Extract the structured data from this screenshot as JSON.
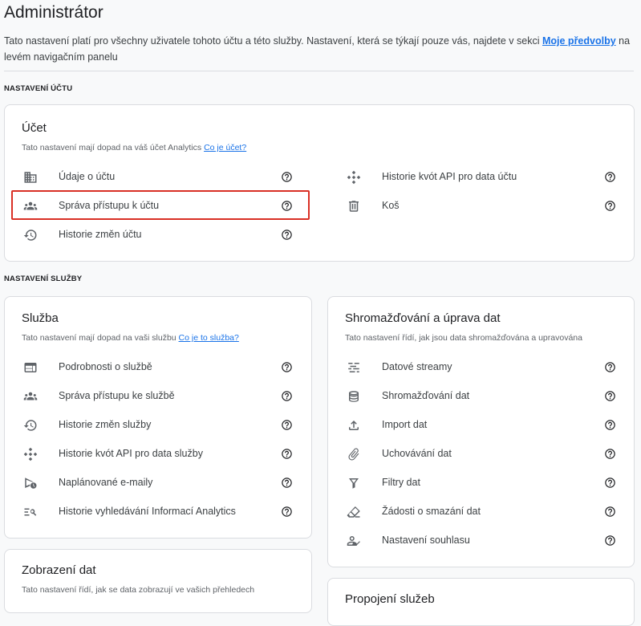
{
  "header": {
    "title": "Administrátor",
    "description_before": "Tato nastavení platí pro všechny uživatele tohoto účtu a této služby. Nastavení, která se týkají pouze vás, najdete v sekci ",
    "description_link": "Moje předvolby",
    "description_after": " na levém navigačním panelu"
  },
  "sections": {
    "account_label": "NASTAVENÍ ÚČTU",
    "property_label": "NASTAVENÍ SLUŽBY"
  },
  "account_card": {
    "title": "Účet",
    "subtitle": "Tato nastavení mají dopad na váš účet Analytics",
    "subtitle_link": "Co je účet?",
    "items": [
      {
        "label": "Údaje o účtu",
        "icon": "building-icon"
      },
      {
        "label": "Správa přístupu k účtu",
        "icon": "people-icon"
      },
      {
        "label": "Historie změn účtu",
        "icon": "history-icon"
      },
      {
        "label": "Historie kvót API pro data účtu",
        "icon": "api-icon"
      },
      {
        "label": "Koš",
        "icon": "trash-icon"
      }
    ]
  },
  "property_card": {
    "title": "Služba",
    "subtitle": "Tato nastavení mají dopad na vaši službu",
    "subtitle_link": "Co je to služba?",
    "items": [
      {
        "label": "Podrobnosti o službě",
        "icon": "web-icon"
      },
      {
        "label": "Správa přístupu ke službě",
        "icon": "people-icon"
      },
      {
        "label": "Historie změn služby",
        "icon": "history-icon"
      },
      {
        "label": "Historie kvót API pro data služby",
        "icon": "api-icon"
      },
      {
        "label": "Naplánované e-maily",
        "icon": "scheduled-send-icon"
      },
      {
        "label": "Historie vyhledávání Informací Analytics",
        "icon": "search-list-icon"
      }
    ]
  },
  "data_card": {
    "title": "Shromažďování a úprava dat",
    "subtitle": "Tato nastavení řídí, jak jsou data shromažďována a upravována",
    "items": [
      {
        "label": "Datové streamy",
        "icon": "streams-icon"
      },
      {
        "label": "Shromažďování dat",
        "icon": "database-icon"
      },
      {
        "label": "Import dat",
        "icon": "upload-icon"
      },
      {
        "label": "Uchovávání dat",
        "icon": "paperclip-icon"
      },
      {
        "label": "Filtry dat",
        "icon": "filter-icon"
      },
      {
        "label": "Žádosti o smazání dat",
        "icon": "eraser-icon"
      },
      {
        "label": "Nastavení souhlasu",
        "icon": "consent-icon"
      }
    ]
  },
  "display_card": {
    "title": "Zobrazení dat",
    "subtitle": "Tato nastavení řídí, jak se data zobrazují ve vašich přehledech"
  },
  "links_card": {
    "title": "Propojení služeb"
  }
}
